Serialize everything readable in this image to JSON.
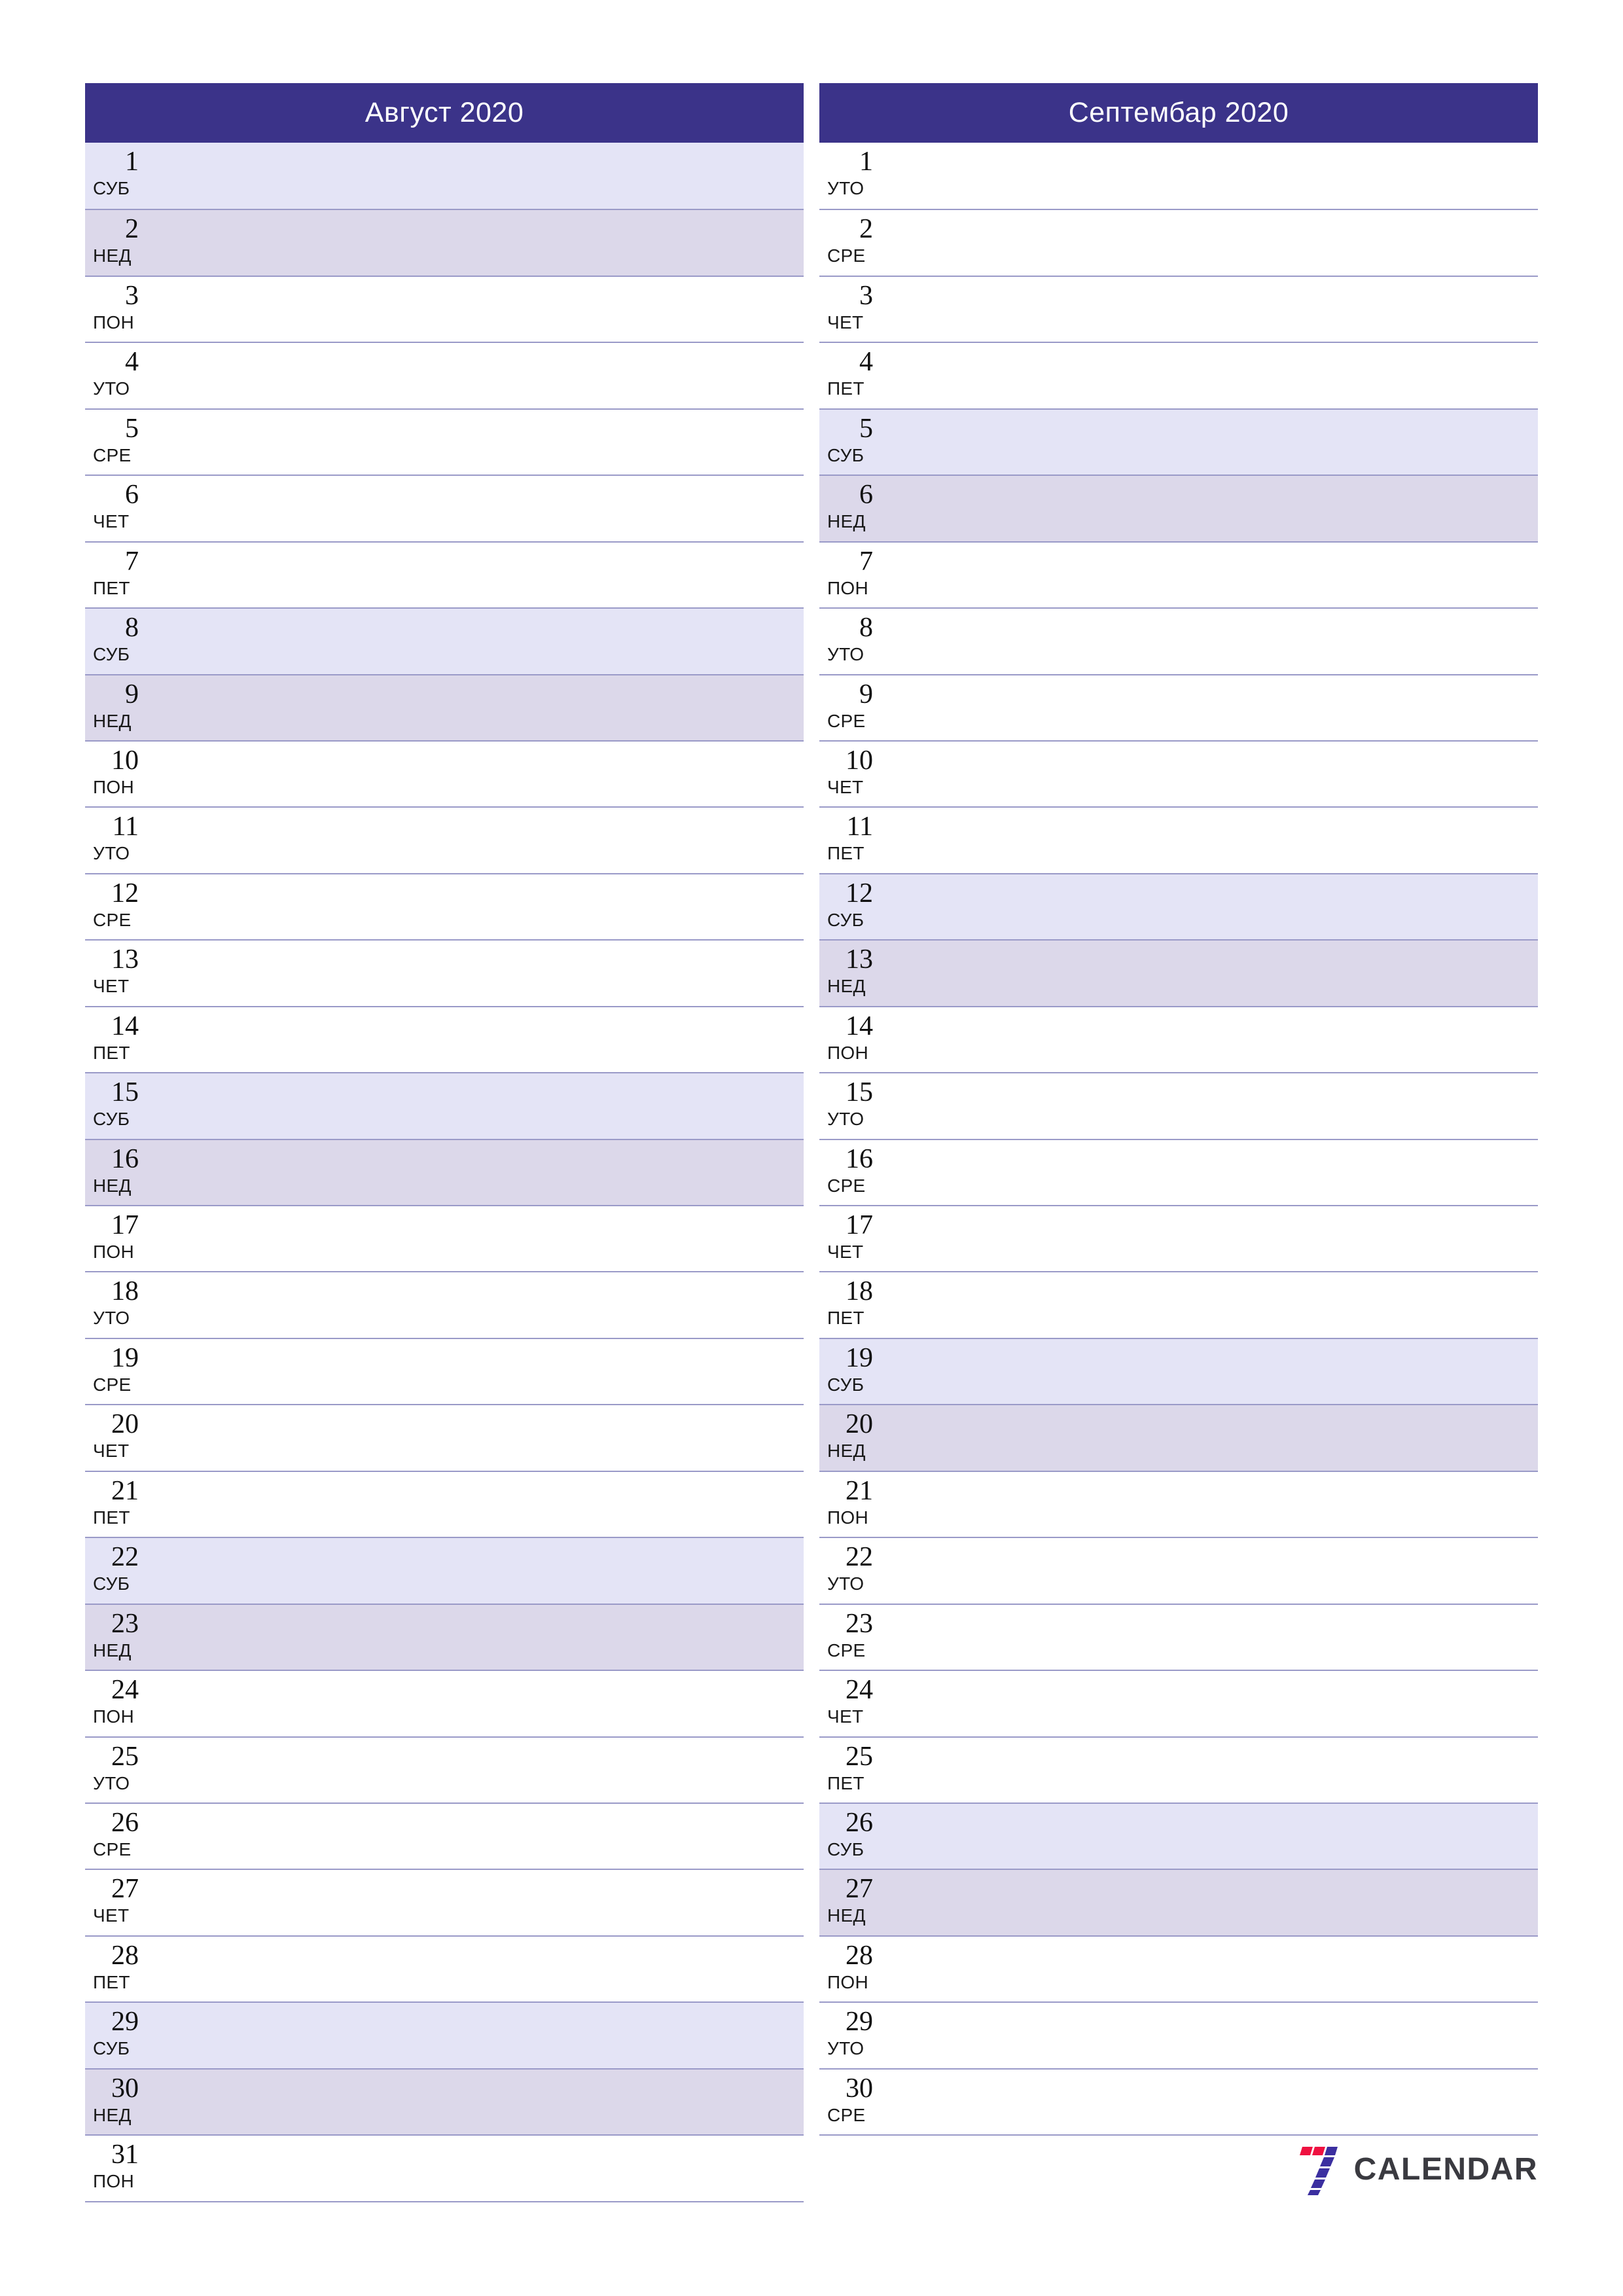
{
  "document": {
    "type": "monthly-planner",
    "orientation": "portrait",
    "locale": "sr"
  },
  "colors": {
    "header_bg": "#3b3389",
    "header_text": "#ffffff",
    "saturday_bg": "#e4e4f6",
    "sunday_bg": "#dcd8ea",
    "row_border": "#9a9ac8",
    "logo_red": "#ef1140",
    "logo_blue": "#3b2fa0",
    "logo_text": "#3a3a40"
  },
  "months": [
    {
      "title": "Август 2020",
      "days": [
        {
          "num": "1",
          "abbr": "СУБ",
          "kind": "sat"
        },
        {
          "num": "2",
          "abbr": "НЕД",
          "kind": "sun"
        },
        {
          "num": "3",
          "abbr": "ПОН",
          "kind": "wd"
        },
        {
          "num": "4",
          "abbr": "УТО",
          "kind": "wd"
        },
        {
          "num": "5",
          "abbr": "СРЕ",
          "kind": "wd"
        },
        {
          "num": "6",
          "abbr": "ЧЕТ",
          "kind": "wd"
        },
        {
          "num": "7",
          "abbr": "ПЕТ",
          "kind": "wd"
        },
        {
          "num": "8",
          "abbr": "СУБ",
          "kind": "sat"
        },
        {
          "num": "9",
          "abbr": "НЕД",
          "kind": "sun"
        },
        {
          "num": "10",
          "abbr": "ПОН",
          "kind": "wd"
        },
        {
          "num": "11",
          "abbr": "УТО",
          "kind": "wd"
        },
        {
          "num": "12",
          "abbr": "СРЕ",
          "kind": "wd"
        },
        {
          "num": "13",
          "abbr": "ЧЕТ",
          "kind": "wd"
        },
        {
          "num": "14",
          "abbr": "ПЕТ",
          "kind": "wd"
        },
        {
          "num": "15",
          "abbr": "СУБ",
          "kind": "sat"
        },
        {
          "num": "16",
          "abbr": "НЕД",
          "kind": "sun"
        },
        {
          "num": "17",
          "abbr": "ПОН",
          "kind": "wd"
        },
        {
          "num": "18",
          "abbr": "УТО",
          "kind": "wd"
        },
        {
          "num": "19",
          "abbr": "СРЕ",
          "kind": "wd"
        },
        {
          "num": "20",
          "abbr": "ЧЕТ",
          "kind": "wd"
        },
        {
          "num": "21",
          "abbr": "ПЕТ",
          "kind": "wd"
        },
        {
          "num": "22",
          "abbr": "СУБ",
          "kind": "sat"
        },
        {
          "num": "23",
          "abbr": "НЕД",
          "kind": "sun"
        },
        {
          "num": "24",
          "abbr": "ПОН",
          "kind": "wd"
        },
        {
          "num": "25",
          "abbr": "УТО",
          "kind": "wd"
        },
        {
          "num": "26",
          "abbr": "СРЕ",
          "kind": "wd"
        },
        {
          "num": "27",
          "abbr": "ЧЕТ",
          "kind": "wd"
        },
        {
          "num": "28",
          "abbr": "ПЕТ",
          "kind": "wd"
        },
        {
          "num": "29",
          "abbr": "СУБ",
          "kind": "sat"
        },
        {
          "num": "30",
          "abbr": "НЕД",
          "kind": "sun"
        },
        {
          "num": "31",
          "abbr": "ПОН",
          "kind": "wd"
        }
      ]
    },
    {
      "title": "Септембар 2020",
      "days": [
        {
          "num": "1",
          "abbr": "УТО",
          "kind": "wd"
        },
        {
          "num": "2",
          "abbr": "СРЕ",
          "kind": "wd"
        },
        {
          "num": "3",
          "abbr": "ЧЕТ",
          "kind": "wd"
        },
        {
          "num": "4",
          "abbr": "ПЕТ",
          "kind": "wd"
        },
        {
          "num": "5",
          "abbr": "СУБ",
          "kind": "sat"
        },
        {
          "num": "6",
          "abbr": "НЕД",
          "kind": "sun"
        },
        {
          "num": "7",
          "abbr": "ПОН",
          "kind": "wd"
        },
        {
          "num": "8",
          "abbr": "УТО",
          "kind": "wd"
        },
        {
          "num": "9",
          "abbr": "СРЕ",
          "kind": "wd"
        },
        {
          "num": "10",
          "abbr": "ЧЕТ",
          "kind": "wd"
        },
        {
          "num": "11",
          "abbr": "ПЕТ",
          "kind": "wd"
        },
        {
          "num": "12",
          "abbr": "СУБ",
          "kind": "sat"
        },
        {
          "num": "13",
          "abbr": "НЕД",
          "kind": "sun"
        },
        {
          "num": "14",
          "abbr": "ПОН",
          "kind": "wd"
        },
        {
          "num": "15",
          "abbr": "УТО",
          "kind": "wd"
        },
        {
          "num": "16",
          "abbr": "СРЕ",
          "kind": "wd"
        },
        {
          "num": "17",
          "abbr": "ЧЕТ",
          "kind": "wd"
        },
        {
          "num": "18",
          "abbr": "ПЕТ",
          "kind": "wd"
        },
        {
          "num": "19",
          "abbr": "СУБ",
          "kind": "sat"
        },
        {
          "num": "20",
          "abbr": "НЕД",
          "kind": "sun"
        },
        {
          "num": "21",
          "abbr": "ПОН",
          "kind": "wd"
        },
        {
          "num": "22",
          "abbr": "УТО",
          "kind": "wd"
        },
        {
          "num": "23",
          "abbr": "СРЕ",
          "kind": "wd"
        },
        {
          "num": "24",
          "abbr": "ЧЕТ",
          "kind": "wd"
        },
        {
          "num": "25",
          "abbr": "ПЕТ",
          "kind": "wd"
        },
        {
          "num": "26",
          "abbr": "СУБ",
          "kind": "sat"
        },
        {
          "num": "27",
          "abbr": "НЕД",
          "kind": "sun"
        },
        {
          "num": "28",
          "abbr": "ПОН",
          "kind": "wd"
        },
        {
          "num": "29",
          "abbr": "УТО",
          "kind": "wd"
        },
        {
          "num": "30",
          "abbr": "СРЕ",
          "kind": "wd"
        }
      ]
    }
  ],
  "footer": {
    "logo_icon": "seven-logo-icon",
    "logo_text": "CALENDAR"
  }
}
